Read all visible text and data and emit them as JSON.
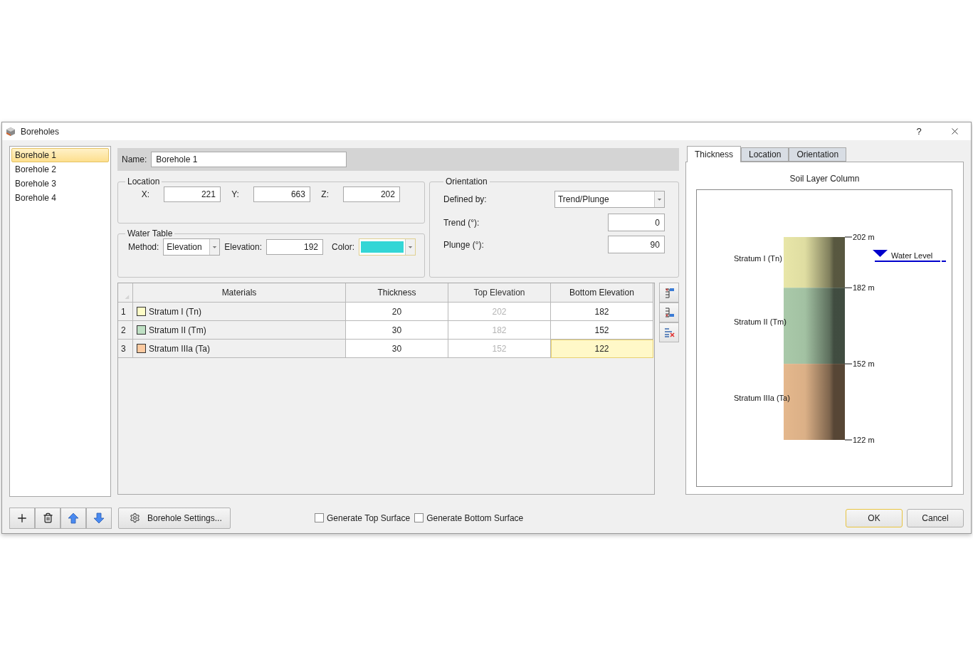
{
  "window": {
    "title": "Boreholes",
    "help": "?"
  },
  "boreholes": [
    {
      "label": "Borehole 1",
      "selected": true
    },
    {
      "label": "Borehole 2",
      "selected": false
    },
    {
      "label": "Borehole 3",
      "selected": false
    },
    {
      "label": "Borehole 4",
      "selected": false
    }
  ],
  "name": {
    "label": "Name:",
    "value": "Borehole 1"
  },
  "location": {
    "title": "Location",
    "fields": [
      {
        "label": "X:",
        "value": "221"
      },
      {
        "label": "Y:",
        "value": "663"
      },
      {
        "label": "Z:",
        "value": "202"
      }
    ]
  },
  "water_table": {
    "title": "Water Table",
    "method_label": "Method:",
    "method": "Elevation",
    "elevation_label": "Elevation:",
    "elevation": "192",
    "color_label": "Color:",
    "color": "#33d6d6"
  },
  "orientation": {
    "title": "Orientation",
    "defined_by_label": "Defined by:",
    "defined_by": "Trend/Plunge",
    "trend_label": "Trend (°):",
    "trend": "0",
    "plunge_label": "Plunge (°):",
    "plunge": "90"
  },
  "table": {
    "columns": [
      {
        "label": "Materials",
        "disabled": false
      },
      {
        "label": "Thickness",
        "disabled": false
      },
      {
        "label": "Top Elevation",
        "disabled": true
      },
      {
        "label": "Bottom Elevation",
        "disabled": false
      }
    ],
    "rows": [
      {
        "number": "1",
        "color": "#fdfcc6",
        "cells": [
          "Stratum I (Tn)",
          "20",
          "202",
          "182"
        ],
        "selected": false
      },
      {
        "number": "2",
        "color": "#bfe0c4",
        "cells": [
          "Stratum II (Tm)",
          "30",
          "182",
          "152"
        ],
        "selected": false
      },
      {
        "number": "3",
        "color": "#fdcaa0",
        "cells": [
          "Stratum IIIa (Ta)",
          "30",
          "152",
          "122"
        ],
        "selected": true
      }
    ]
  },
  "tabs": [
    {
      "label": "Thickness",
      "selected": true
    },
    {
      "label": "Location",
      "selected": false
    },
    {
      "label": "Orientation",
      "selected": false
    }
  ],
  "column": {
    "title": "Soil Layer Column",
    "layers": [
      {
        "label": "Stratum I (Tn)",
        "color": "#e8e6a8"
      },
      {
        "label": "Stratum II (Tm)",
        "color": "#a9c9a9"
      },
      {
        "label": "Stratum IIIa (Ta)",
        "color": "#e4b78c"
      }
    ],
    "elevations": [
      "202 m",
      "182 m",
      "152 m",
      "122 m"
    ],
    "water_level": "Water Level"
  },
  "settings_button": "Borehole Settings...",
  "checkboxes": [
    {
      "label": "Generate Top Surface",
      "checked": false
    },
    {
      "label": "Generate Bottom Surface",
      "checked": false
    }
  ],
  "buttons": [
    {
      "label": "OK",
      "default": true
    },
    {
      "label": "Cancel",
      "default": false
    }
  ]
}
